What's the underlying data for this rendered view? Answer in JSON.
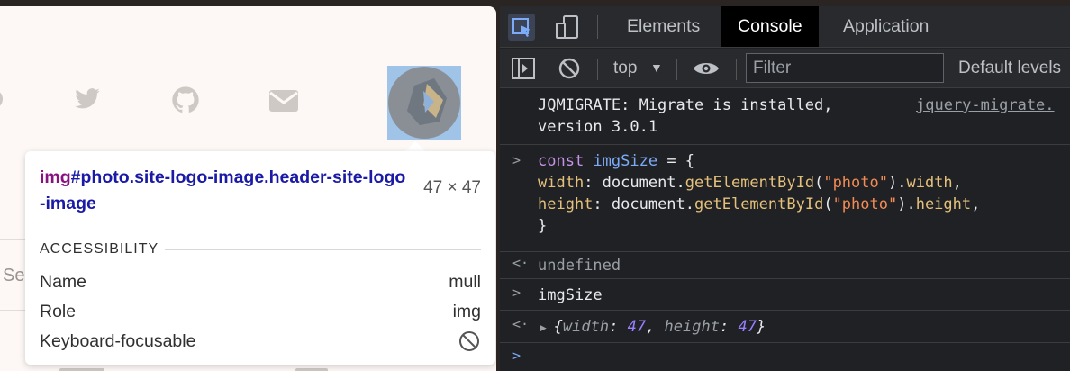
{
  "page": {
    "social_icons": [
      "github-circle-icon",
      "twitter-icon",
      "github-icon",
      "envelope-icon"
    ],
    "search_fragment": "Se"
  },
  "tooltip": {
    "tag": "img",
    "selector_rest": "#photo.site-logo-image.header-site-logo-image",
    "size": "47 × 47",
    "section_title": "ACCESSIBILITY",
    "rows": [
      {
        "key": "Name",
        "value": "mull"
      },
      {
        "key": "Role",
        "value": "img"
      },
      {
        "key": "Keyboard-focusable",
        "icon": "not-allowed-icon"
      }
    ]
  },
  "devtools": {
    "tabs": [
      {
        "label": "Elements",
        "active": false
      },
      {
        "label": "Console",
        "active": true
      },
      {
        "label": "Application",
        "active": false
      }
    ],
    "console_toolbar": {
      "context": "top",
      "filter_placeholder": "Filter",
      "levels": "Default levels"
    },
    "messages": {
      "m1_text": "JQMIGRATE: Migrate is installed,\nversion 3.0.1",
      "m1_link": "jquery-migrate.",
      "m2_kw": "const",
      "m2_var": "imgSize",
      "m2_rest": " = {",
      "m2_l2_prop": "width",
      "m2_l2_a": ": document.",
      "m2_l2_fn": "getElementById",
      "m2_l2_b": "(",
      "m2_l2_str": "\"photo\"",
      "m2_l2_c": ").",
      "m2_l2_prop2": "width",
      "m2_l2_d": ",",
      "m2_l3_prop": "height",
      "m2_l3_a": ": document.",
      "m2_l3_fn": "getElementById",
      "m2_l3_b": "(",
      "m2_l3_str": "\"photo\"",
      "m2_l3_c": ").",
      "m2_l3_prop2": "height",
      "m2_l3_d": ",",
      "m2_l4": "}",
      "m3_text": "undefined",
      "m4_text": "imgSize",
      "m5_open": "{",
      "m5_k1": "width",
      "m5_sep1": ": ",
      "m5_v1": "47",
      "m5_comma": ", ",
      "m5_k2": "height",
      "m5_sep2": ": ",
      "m5_v2": "47",
      "m5_close": "}"
    }
  },
  "colors": {
    "page_bg": "#fdf8f5",
    "highlight": "#9fc4e8",
    "devtools_bg": "#202124",
    "tag_color": "#881280",
    "selector_color": "#1a1aa6"
  }
}
